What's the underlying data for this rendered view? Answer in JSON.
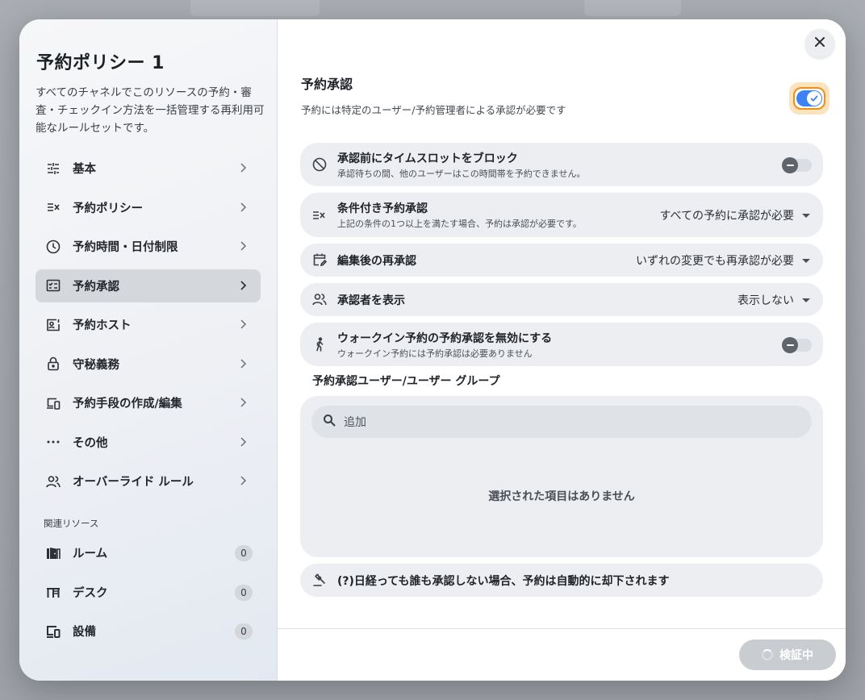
{
  "sidebar": {
    "title": "予約ポリシー 1",
    "description": "すべてのチャネルでこのリソースの予約・審査・チェックイン方法を一括管理する再利用可能なルールセットです。",
    "items": [
      {
        "label": "基本",
        "icon": "sliders-icon"
      },
      {
        "label": "予約ポリシー",
        "icon": "rule-list-icon"
      },
      {
        "label": "予約時間・日付制限",
        "icon": "clock-icon"
      },
      {
        "label": "予約承認",
        "icon": "approval-checklist-icon",
        "active": true
      },
      {
        "label": "予約ホスト",
        "icon": "host-badge-icon"
      },
      {
        "label": "守秘義務",
        "icon": "lock-icon"
      },
      {
        "label": "予約手段の作成/編集",
        "icon": "devices-icon"
      },
      {
        "label": "その他",
        "icon": "more-icon"
      },
      {
        "label": "オーバーライド ルール",
        "icon": "people-icon"
      }
    ],
    "related_label": "関連リソース",
    "resources": [
      {
        "label": "ルーム",
        "count": "0",
        "icon": "door-icon"
      },
      {
        "label": "デスク",
        "count": "0",
        "icon": "desk-icon"
      },
      {
        "label": "設備",
        "count": "0",
        "icon": "equipment-icon"
      }
    ]
  },
  "main": {
    "title": "予約承認",
    "subtitle": "予約には特定のユーザー/予約管理者による承認が必要です",
    "approval_enabled": true,
    "rows": {
      "block": {
        "title": "承認前にタイムスロットをブロック",
        "subtitle": "承認待ちの間、他のユーザーはこの時間帯を予約できません。",
        "enabled": false
      },
      "conditional": {
        "title": "条件付き予約承認",
        "subtitle": "上記の条件の1つ以上を満たす場合、予約は承認が必要です。",
        "value": "すべての予約に承認が必要"
      },
      "reapprove": {
        "title": "編集後の再承認",
        "value": "いずれの変更でも再承認が必要"
      },
      "show_approver": {
        "title": "承認者を表示",
        "value": "表示しない"
      },
      "walkin": {
        "title": "ウォークイン予約の予約承認を無効にする",
        "subtitle": "ウォークイン予約には予約承認は必要ありません",
        "enabled": false
      }
    },
    "group_label": "予約承認ユーザー/ユーザー グループ",
    "search_placeholder": "追加",
    "empty_text": "選択された項目はありません",
    "auto_decline": "(?)日経っても誰も承認しない場合、予約は自動的に却下されます",
    "verify_button": "検証中"
  },
  "colors": {
    "accent": "#3d82f2",
    "focus_ring": "#ef8f13",
    "row_bg": "#eceef1"
  }
}
